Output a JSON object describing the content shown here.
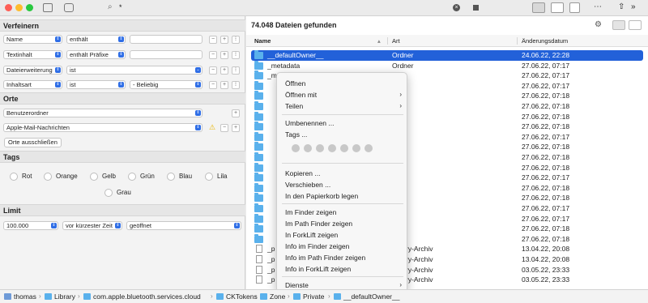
{
  "toolbar": {
    "search_value": "*"
  },
  "refine": {
    "title": "Verfeinern",
    "rules": [
      {
        "field": "Name",
        "op": "enthält",
        "value": ""
      },
      {
        "field": "Textinhalt",
        "op": "enthält Präfixe",
        "value": ""
      },
      {
        "field": "Dateierweiterung",
        "op": "ist",
        "value": ""
      },
      {
        "field": "Inhaltsart",
        "op": "ist",
        "value": "- Beliebig"
      }
    ]
  },
  "places": {
    "title": "Orte",
    "items": [
      "Benutzerordner",
      "Apple-Mail-Nachrichten"
    ],
    "exclude_label": "Orte ausschließen"
  },
  "tags": {
    "title": "Tags",
    "items": [
      "Rot",
      "Orange",
      "Gelb",
      "Grün",
      "Blau",
      "Lila",
      "Grau"
    ]
  },
  "limit": {
    "title": "Limit",
    "count": "100.000",
    "order": "vor kürzester Zeit",
    "type": "geöffnet"
  },
  "results": {
    "title": "74.048 Dateien gefunden",
    "columns": [
      "Name",
      "Art",
      "Änderungsdatum"
    ],
    "rows": [
      {
        "name": "__defaultOwner__",
        "kind": "Ordner",
        "date": "24.06.22, 22:28",
        "selected": true,
        "icon": "folder"
      },
      {
        "name": "_metadata",
        "kind": "Ordner",
        "date": "27.06.22, 07:17",
        "icon": "folder"
      },
      {
        "name": "_metadata",
        "kind": "",
        "date": "27.06.22, 07:17",
        "icon": "folder"
      },
      {
        "name": "",
        "kind": "",
        "date": "27.06.22, 07:17",
        "icon": "folder"
      },
      {
        "name": "",
        "kind": "",
        "date": "27.06.22, 07:18",
        "icon": "folder"
      },
      {
        "name": "",
        "kind": "",
        "date": "27.06.22, 07:18",
        "icon": "folder"
      },
      {
        "name": "",
        "kind": "",
        "date": "27.06.22, 07:18",
        "icon": "folder"
      },
      {
        "name": "",
        "kind": "",
        "date": "27.06.22, 07:18",
        "icon": "folder"
      },
      {
        "name": "",
        "kind": "",
        "date": "27.06.22, 07:17",
        "icon": "folder"
      },
      {
        "name": "",
        "kind": "",
        "date": "27.06.22, 07:18",
        "icon": "folder"
      },
      {
        "name": "",
        "kind": "",
        "date": "27.06.22, 07:18",
        "icon": "folder"
      },
      {
        "name": "",
        "kind": "",
        "date": "27.06.22, 07:18",
        "icon": "folder"
      },
      {
        "name": "",
        "kind": "",
        "date": "27.06.22, 07:17",
        "icon": "folder"
      },
      {
        "name": "",
        "kind": "",
        "date": "27.06.22, 07:18",
        "icon": "folder"
      },
      {
        "name": "",
        "kind": "",
        "date": "27.06.22, 07:18",
        "icon": "folder"
      },
      {
        "name": "",
        "kind": "",
        "date": "27.06.22, 07:17",
        "icon": "folder"
      },
      {
        "name": "",
        "kind": "",
        "date": "27.06.22, 07:17",
        "icon": "folder"
      },
      {
        "name": "",
        "kind": "",
        "date": "27.06.22, 07:18",
        "icon": "folder"
      },
      {
        "name": "",
        "kind": "",
        "date": "27.06.22, 07:18",
        "icon": "folder"
      },
      {
        "name": "_p",
        "kind": "Binary-Archiv",
        "date": "13.04.22, 20:08",
        "icon": "doc"
      },
      {
        "name": "_p",
        "kind": "Binary-Archiv",
        "date": "13.04.22, 20:08",
        "icon": "doc"
      },
      {
        "name": "_p",
        "kind": "Binary-Archiv",
        "date": "03.05.22, 23:33",
        "icon": "doc"
      },
      {
        "name": "_p",
        "kind": "Binary-Archiv",
        "date": "03.05.22, 23:33",
        "icon": "doc"
      }
    ]
  },
  "context_menu": {
    "items": [
      {
        "label": "Öffnen"
      },
      {
        "label": "Öffnen mit",
        "submenu": true
      },
      {
        "label": "Teilen",
        "submenu": true
      },
      {
        "label": "Umbenennen ..."
      },
      {
        "label": "Tags ..."
      },
      {
        "label": "Kopieren ..."
      },
      {
        "label": "Verschieben ..."
      },
      {
        "label": "In den Papierkorb legen"
      },
      {
        "label": "Im Finder zeigen"
      },
      {
        "label": "Im Path Finder zeigen"
      },
      {
        "label": "In ForkLift zeigen"
      },
      {
        "label": "Info im Finder zeigen"
      },
      {
        "label": "Info im Path Finder zeigen"
      },
      {
        "label": "Info in ForkLift zeigen"
      },
      {
        "label": "Dienste",
        "submenu": true
      }
    ]
  },
  "path": [
    "thomas",
    "Library",
    "com.apple.bluetooth.services.cloud",
    "CKTokens",
    "Zone",
    "Private",
    "__defaultOwner__"
  ],
  "colors": {
    "accent": "#2261d9",
    "folder": "#5ab1ec"
  }
}
